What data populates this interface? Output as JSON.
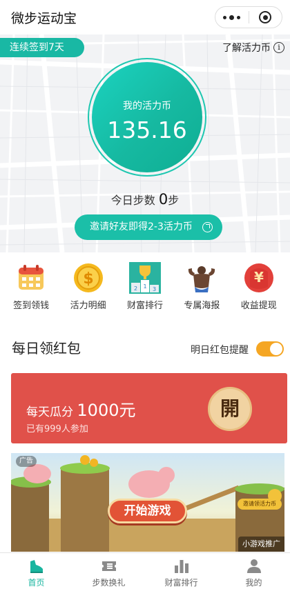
{
  "header": {
    "title": "微步运动宝"
  },
  "hero": {
    "streak_label": "连续签到7天",
    "learn_link": "了解活力币",
    "coin_label": "我的活力币",
    "coin_value": "135.16",
    "steps_prefix": "今日步数",
    "steps_value": "0",
    "steps_unit": "步",
    "invite_label": "邀请好友即得2-3活力币"
  },
  "quick_nav": [
    {
      "label": "签到领钱",
      "icon": "calendar-icon"
    },
    {
      "label": "活力明细",
      "icon": "coin-dollar-icon"
    },
    {
      "label": "财富排行",
      "icon": "trophy-icon"
    },
    {
      "label": "专属海报",
      "icon": "strongman-icon"
    },
    {
      "label": "收益提现",
      "icon": "yen-envelope-icon"
    }
  ],
  "daily": {
    "title": "每日领红包",
    "remind_label": "明日红包提醒",
    "remind_on": true,
    "card_prefix": "每天瓜分",
    "card_amount": "1000元",
    "card_sub": "已有999人参加",
    "open_label": "開"
  },
  "ad": {
    "tag": "广告",
    "play_label": "开始游戏",
    "note": "邀请领活力币",
    "brand": "小游戏推广"
  },
  "tabbar": [
    {
      "label": "首页",
      "icon": "shoe-icon",
      "active": true
    },
    {
      "label": "步数换礼",
      "icon": "ticket-icon",
      "active": false
    },
    {
      "label": "财富排行",
      "icon": "bar-chart-icon",
      "active": false
    },
    {
      "label": "我的",
      "icon": "person-icon",
      "active": false
    }
  ],
  "colors": {
    "accent": "#19b8a4",
    "red_card": "#e0514a",
    "toggle": "#f5a623"
  }
}
